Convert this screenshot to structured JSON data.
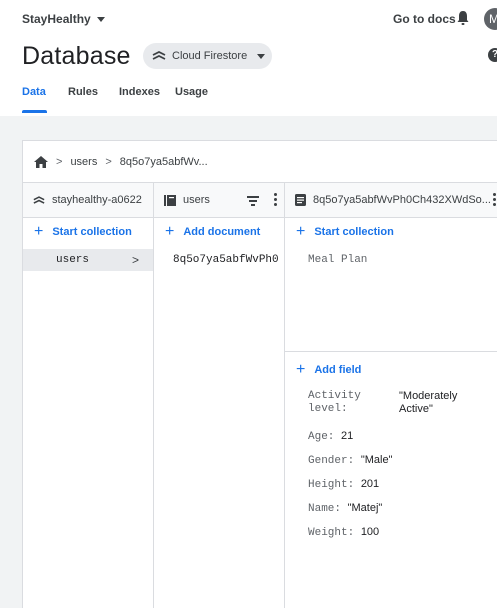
{
  "topbar": {
    "project": "StayHealthy",
    "docs_link": "Go to docs",
    "avatar_initial": "M"
  },
  "header": {
    "title": "Database",
    "database_selector": "Cloud Firestore"
  },
  "tabs": [
    {
      "label": "Data",
      "active": true
    },
    {
      "label": "Rules",
      "active": false
    },
    {
      "label": "Indexes",
      "active": false
    },
    {
      "label": "Usage",
      "active": false
    }
  ],
  "breadcrumb": {
    "collection": "users",
    "document": "8q5o7ya5abfWv..."
  },
  "columns": {
    "root": {
      "title": "stayhealthy-a0622",
      "action": "Start collection",
      "items": [
        {
          "label": "users",
          "selected": true
        }
      ]
    },
    "collection": {
      "title": "users",
      "action": "Add document",
      "items": [
        {
          "label": "8q5o7ya5abfWvPh0"
        }
      ]
    },
    "document": {
      "title": "8q5o7ya5abfWvPh0Ch432XWdSo...",
      "action_collection": "Start collection",
      "subcollections": [
        "Meal Plan"
      ],
      "action_field": "Add field",
      "fields": [
        {
          "key": "Activity level:",
          "value": "\"Moderately Active\""
        },
        {
          "key": "Age:",
          "value": "21"
        },
        {
          "key": "Gender:",
          "value": "\"Male\""
        },
        {
          "key": "Height:",
          "value": "201"
        },
        {
          "key": "Name:",
          "value": "\"Matej\""
        },
        {
          "key": "Weight:",
          "value": "100"
        }
      ]
    }
  },
  "colors": {
    "accent": "#1a73e8",
    "content_bg": "#f1f3f4",
    "selected_row": "#e8eaed"
  }
}
